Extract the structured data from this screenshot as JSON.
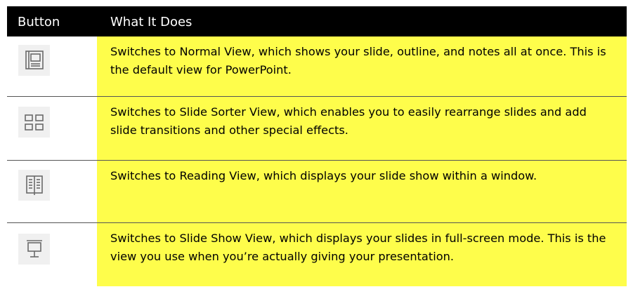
{
  "table": {
    "headers": {
      "button": "Button",
      "description": "What It Does"
    },
    "rows": [
      {
        "icon": "normal-view-icon",
        "text": "Switches to Normal View, which shows your slide, outline, and notes all at once. This is the default view for PowerPoint."
      },
      {
        "icon": "slide-sorter-view-icon",
        "text": "Switches to Slide Sorter View, which enables you to easily rearrange slides and add slide transitions and other special effects."
      },
      {
        "icon": "reading-view-icon",
        "text": "Switches to Reading View, which displays your slide show within a window."
      },
      {
        "icon": "slide-show-view-icon",
        "text": "Switches to Slide Show View, which displays your slides in full-screen mode. This is the view you use when you’re actually giving your presentation."
      }
    ]
  },
  "colors": {
    "header_bg": "#000000",
    "highlight": "#fefd4b",
    "icon_bg": "#f0f0f0",
    "icon_stroke": "#6a6a6a"
  }
}
